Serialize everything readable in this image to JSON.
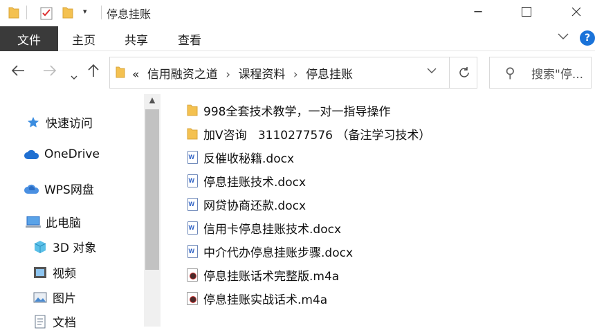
{
  "window": {
    "title": "停息挂账"
  },
  "ribbon": {
    "tabs": [
      {
        "label": "文件"
      },
      {
        "label": "主页"
      },
      {
        "label": "共享"
      },
      {
        "label": "查看"
      }
    ],
    "help_label": "?"
  },
  "address": {
    "prefix": "«",
    "crumbs": [
      "信用融资之道",
      "课程资料",
      "停息挂账"
    ],
    "separator": "›"
  },
  "search": {
    "placeholder": "搜索\"停..."
  },
  "sidebar": {
    "items": [
      {
        "label": "快速访问",
        "icon": "star-icon"
      },
      {
        "label": "OneDrive",
        "icon": "cloud-icon"
      },
      {
        "label": "WPS网盘",
        "icon": "wps-cloud-icon"
      },
      {
        "label": "此电脑",
        "icon": "computer-icon"
      },
      {
        "label": "3D 对象",
        "icon": "cube-3d-icon"
      },
      {
        "label": "视频",
        "icon": "video-icon"
      },
      {
        "label": "图片",
        "icon": "picture-icon"
      },
      {
        "label": "文档",
        "icon": "document-icon"
      }
    ]
  },
  "files": [
    {
      "name": "998全套技术教学，一对一指导操作",
      "type": "folder"
    },
    {
      "name": "加V咨询   3110277576 （备注学习技术）",
      "type": "folder"
    },
    {
      "name": "反催收秘籍.docx",
      "type": "docx"
    },
    {
      "name": "停息挂账技术.docx",
      "type": "docx"
    },
    {
      "name": "网贷协商还款.docx",
      "type": "docx"
    },
    {
      "name": "信用卡停息挂账技术.docx",
      "type": "docx"
    },
    {
      "name": "中介代办停息挂账步骤.docx",
      "type": "docx"
    },
    {
      "name": "停息挂账话术完整版.m4a",
      "type": "m4a"
    },
    {
      "name": "停息挂账实战话术.m4a",
      "type": "m4a"
    }
  ],
  "colors": {
    "folder": "#f4c150",
    "file_tab_bg": "#3a3a3a",
    "accent": "#1a73d9"
  }
}
